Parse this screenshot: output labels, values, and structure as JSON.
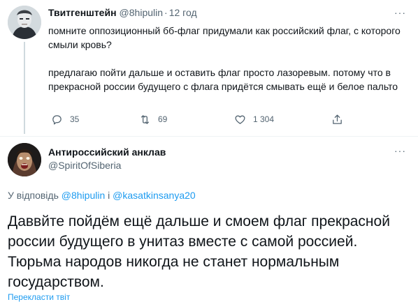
{
  "tweet": {
    "author_name": "Твитгенштейн",
    "author_handle": "@8hipulin",
    "dot": "·",
    "time": "12 год",
    "more": "···",
    "paragraph1": "помните оппозиционный бб-флаг придумали как российский флаг, с которого смыли кровь?",
    "paragraph2": "предлагаю пойти дальше и оставить флаг просто лазоревым. потому что в прекрасной россии будущего с флага придётся смывать ещё и белое пальто",
    "replies": "35",
    "retweets": "69",
    "likes": "1 304"
  },
  "reply": {
    "author_name": "Антироссийский анклав",
    "author_handle": "@SpiritOfSiberia",
    "more": "···",
    "reply_prefix": "У відповідь",
    "mention1": "@8hipulin",
    "and_word": "і",
    "mention2": "@kasatkinsanya20",
    "text": "Даввйте пойдём ещё дальше и  смоем флаг прекрасной россии будущего в унитаз вместе с самой россией. Тюрьма народов никогда не станет нормальным государством.",
    "translate": "Перекласти твіт"
  },
  "icons": {
    "reply": "reply-icon",
    "retweet": "retweet-icon",
    "like": "heart-icon",
    "share": "share-icon",
    "more": "more-icon"
  },
  "colors": {
    "text": "#0f1419",
    "secondary": "#536471",
    "link": "#1d9bf0",
    "border": "#eff3f4",
    "thread_line": "#cfd9de"
  }
}
